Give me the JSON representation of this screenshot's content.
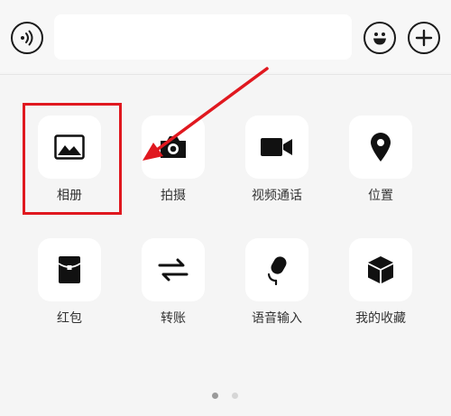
{
  "input": {
    "value": "",
    "placeholder": ""
  },
  "actions": [
    {
      "label": "相册",
      "icon": "image-icon"
    },
    {
      "label": "拍摄",
      "icon": "camera-icon"
    },
    {
      "label": "视频通话",
      "icon": "video-camera-icon"
    },
    {
      "label": "位置",
      "icon": "location-pin-icon"
    },
    {
      "label": "红包",
      "icon": "red-packet-icon"
    },
    {
      "label": "转账",
      "icon": "transfer-icon"
    },
    {
      "label": "语音输入",
      "icon": "microphone-icon"
    },
    {
      "label": "我的收藏",
      "icon": "favorites-box-icon"
    }
  ],
  "pagination": {
    "pages": 2,
    "current": 1
  },
  "colors": {
    "annotation": "#e0181f",
    "icon": "#111111",
    "dot_active": "#9a9a9a",
    "dot_inactive": "#d6d6d6"
  }
}
